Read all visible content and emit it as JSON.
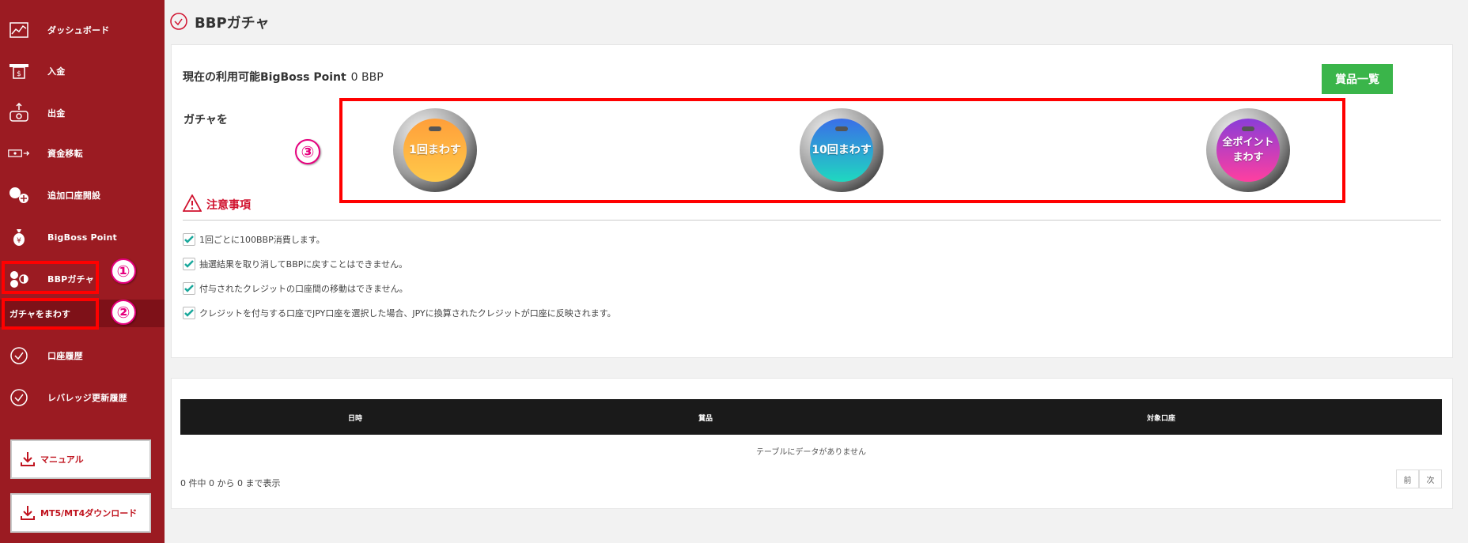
{
  "sidebar": {
    "items": [
      {
        "label": "ダッシュボード",
        "icon": "chart-icon"
      },
      {
        "label": "入金",
        "icon": "atm-icon"
      },
      {
        "label": "出金",
        "icon": "cash-icon"
      },
      {
        "label": "資金移転",
        "icon": "transfer-icon"
      },
      {
        "label": "追加口座開設",
        "icon": "add-user-icon"
      },
      {
        "label": "BigBoss Point",
        "icon": "point-bag-icon"
      },
      {
        "label": "BBPガチャ",
        "icon": "gacha-icon"
      },
      {
        "label": "口座履歴",
        "icon": "clock-check-icon"
      },
      {
        "label": "レバレッジ更新履歴",
        "icon": "clock-check-icon"
      }
    ],
    "sub_item": "ガチャをまわす",
    "manual_button": "マニュアル",
    "download_button": "MT5/MT4ダウンロード"
  },
  "annotations": {
    "one": "①",
    "two": "②",
    "three": "③"
  },
  "page": {
    "title": "BBPガチャ"
  },
  "points": {
    "label": "現在の利用可能BigBoss Point",
    "value": "0 BBP"
  },
  "prize_button": "賞品一覧",
  "gacha": {
    "label": "ガチャを",
    "buttons": [
      {
        "label": "1回まわす"
      },
      {
        "label_line1": "10回まわす"
      },
      {
        "label_line1": "全ポイント",
        "label_line2": "まわす"
      }
    ]
  },
  "notice": {
    "title": "注意事項",
    "items": [
      "1回ごとに100BBP消費します。",
      "抽選結果を取り消してBBPに戻すことはできません。",
      "付与されたクレジットの口座間の移動はできません。",
      "クレジットを付与する口座でJPY口座を選択した場合、JPYに換算されたクレジットが口座に反映されます。"
    ]
  },
  "table": {
    "columns": [
      "日時",
      "賞品",
      "対象口座"
    ],
    "empty_message": "テーブルにデータがありません",
    "info": "0 件中 0 から 0 まで表示",
    "prev": "前",
    "next": "次"
  },
  "colors": {
    "sidebar": "#9b1b22",
    "accent_red": "#d0122e",
    "prize_button": "#3ab54a",
    "annotation_red": "#ff0000",
    "annotation_badge": "#e6007e"
  }
}
